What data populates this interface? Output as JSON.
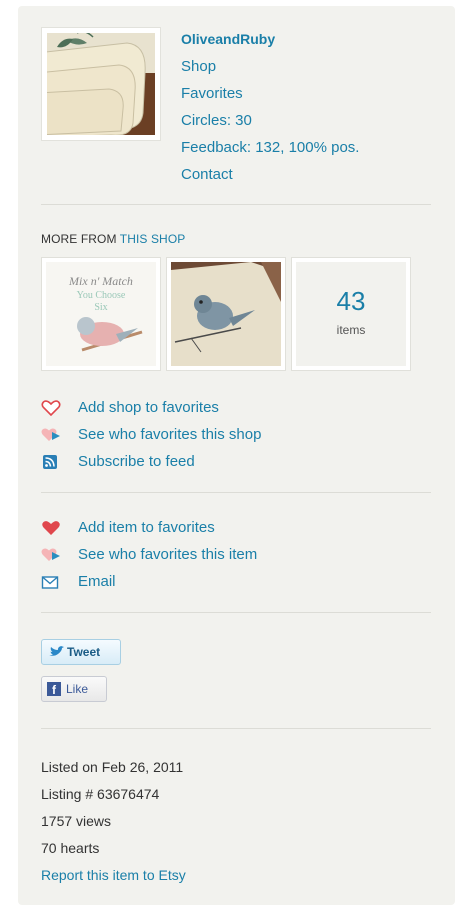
{
  "shop": {
    "name": "OliveandRuby",
    "links": {
      "shop": "Shop",
      "favorites": "Favorites",
      "circles": "Circles: 30",
      "feedback": "Feedback: 132, 100% pos.",
      "contact": "Contact"
    }
  },
  "more_from": {
    "prefix": "MORE FROM ",
    "link": "THIS SHOP",
    "thumb1": {
      "line1": "Mix n' Match",
      "line2": "You Choose",
      "line3": "Six"
    },
    "count": "43",
    "count_label": "items"
  },
  "shop_actions": {
    "add_favorite": "Add shop to favorites",
    "see_who": "See who favorites this shop",
    "subscribe": "Subscribe to feed"
  },
  "item_actions": {
    "add_favorite": "Add item to favorites",
    "see_who": "See who favorites this item",
    "email": "Email"
  },
  "social": {
    "tweet": "Tweet",
    "like": "Like"
  },
  "listing": {
    "listed_on": "Listed on Feb 26, 2011",
    "listing_number": "Listing # 63676474",
    "views": "1757 views",
    "hearts": "70 hearts",
    "report": "Report this item to Etsy"
  },
  "colors": {
    "link": "#1a7fa8",
    "panel_bg": "#f2f2ee",
    "heart": "#e0474c"
  }
}
